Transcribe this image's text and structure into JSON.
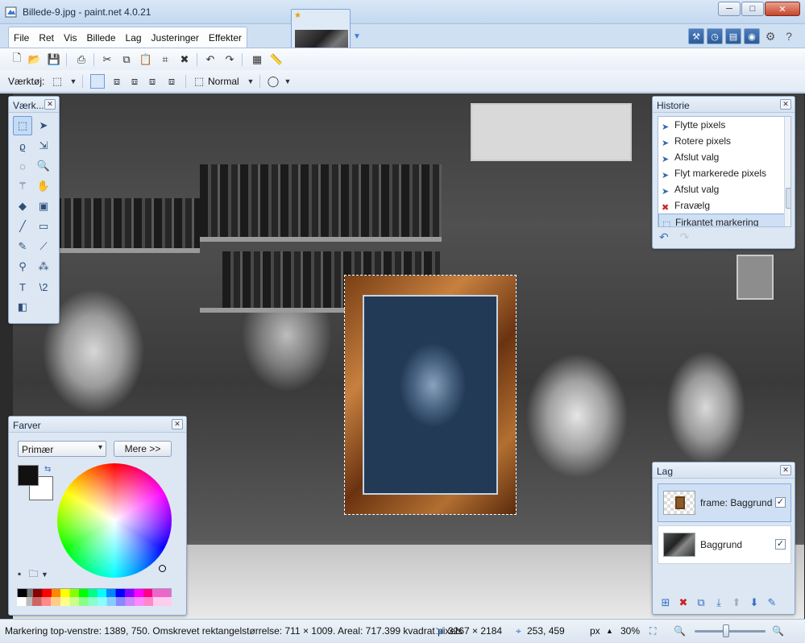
{
  "window": {
    "title": "Billede-9.jpg - paint.net 4.0.21",
    "minimize": "─",
    "maximize": "□",
    "close": "✕"
  },
  "menu": [
    "File",
    "Ret",
    "Vis",
    "Billede",
    "Lag",
    "Justeringer",
    "Effekter"
  ],
  "toolbar": {
    "tool_label": "Værktøj:",
    "blend_mode": "Normal"
  },
  "tools_panel": {
    "title": "Værk..."
  },
  "history": {
    "title": "Historie",
    "items": [
      {
        "label": "Flytte pixels",
        "icon": "move-pixels-icon"
      },
      {
        "label": "Rotere pixels",
        "icon": "move-pixels-icon"
      },
      {
        "label": "Afslut valg",
        "icon": "move-selection-icon"
      },
      {
        "label": "Flyt markerede pixels",
        "icon": "move-pixels-icon"
      },
      {
        "label": "Afslut valg",
        "icon": "move-selection-icon"
      },
      {
        "label": "Fravælg",
        "icon": "deselect-icon"
      },
      {
        "label": "Firkantet markering",
        "icon": "rectangle-select-icon"
      }
    ],
    "selected_index": 6
  },
  "colors": {
    "title": "Farver",
    "mode": "Primær",
    "more_button": "Mere >>",
    "primary": "#111111",
    "secondary": "#ffffff"
  },
  "layers": {
    "title": "Lag",
    "items": [
      {
        "name": "frame: Baggrund",
        "visible": true,
        "selected": true
      },
      {
        "name": "Baggrund",
        "visible": true,
        "selected": false
      }
    ]
  },
  "status": {
    "selection_info": "Markering top-venstre: 1389, 750. Omskrevet rektangelstørrelse: 711 × 1009. Areal: 717.399 kvadrat pixels",
    "image_size": "3267 × 2184",
    "cursor_pos": "253, 459",
    "unit": "px",
    "zoom": "30%"
  }
}
